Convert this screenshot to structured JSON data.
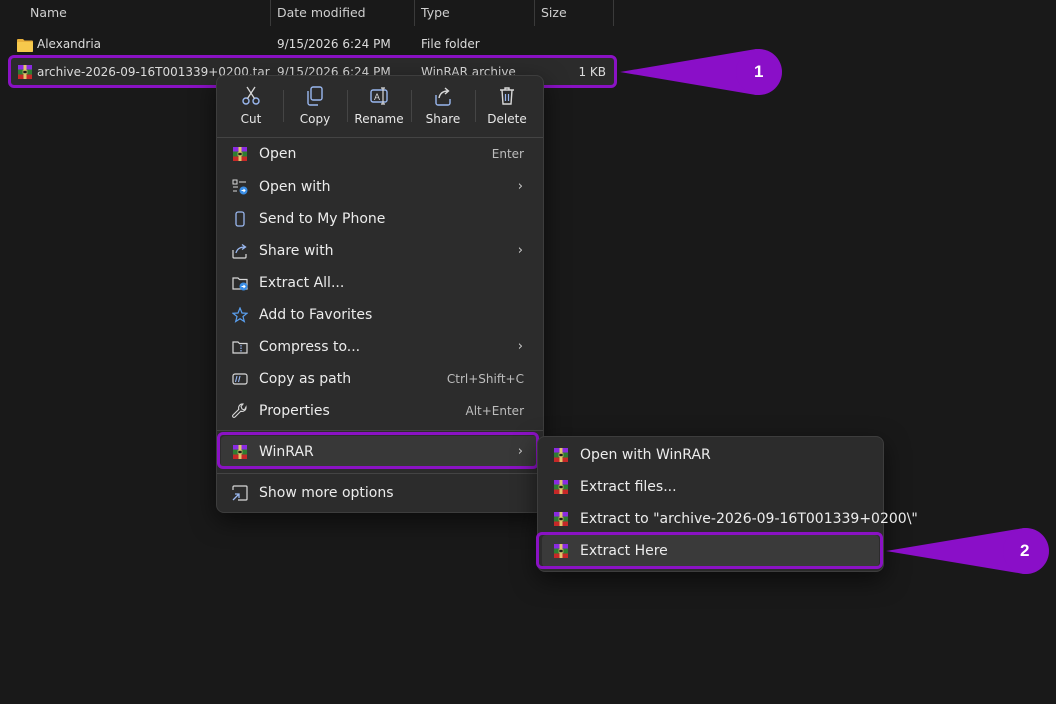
{
  "columns": {
    "name": "Name",
    "date_modified": "Date modified",
    "type": "Type",
    "size": "Size"
  },
  "files": [
    {
      "name": "Alexandria",
      "date": "9/15/2026 6:24 PM",
      "type": "File folder",
      "size": "",
      "icon": "folder-icon"
    },
    {
      "name": "archive-2026-09-16T001339+0200.tar",
      "date": "9/15/2026 6:24 PM",
      "type": "WinRAR archive",
      "size": "1 KB",
      "icon": "winrar-icon"
    }
  ],
  "quick_actions": [
    {
      "label": "Cut",
      "icon": "scissors-icon"
    },
    {
      "label": "Copy",
      "icon": "copy-icon"
    },
    {
      "label": "Rename",
      "icon": "rename-icon"
    },
    {
      "label": "Share",
      "icon": "share-icon"
    },
    {
      "label": "Delete",
      "icon": "trash-icon"
    }
  ],
  "menu_items": [
    {
      "label": "Open",
      "shortcut": "Enter",
      "icon": "winrar-icon"
    },
    {
      "label": "Open with",
      "shortcut": "",
      "icon": "open-with-icon",
      "submenu": true
    },
    {
      "label": "Send to My Phone",
      "shortcut": "",
      "icon": "phone-icon"
    },
    {
      "label": "Share with",
      "shortcut": "",
      "icon": "share-icon",
      "submenu": true
    },
    {
      "label": "Extract All...",
      "shortcut": "",
      "icon": "extract-folder-icon"
    },
    {
      "label": "Add to Favorites",
      "shortcut": "",
      "icon": "star-icon"
    },
    {
      "label": "Compress to...",
      "shortcut": "",
      "icon": "compress-folder-icon",
      "submenu": true
    },
    {
      "label": "Copy as path",
      "shortcut": "Ctrl+Shift+C",
      "icon": "path-icon"
    },
    {
      "label": "Properties",
      "shortcut": "Alt+Enter",
      "icon": "wrench-icon"
    },
    {
      "label": "WinRAR",
      "shortcut": "",
      "icon": "winrar-icon",
      "submenu": true
    },
    {
      "label": "Show more options",
      "shortcut": "",
      "icon": "more-options-icon"
    }
  ],
  "winrar_submenu": [
    {
      "label": "Open with WinRAR",
      "icon": "winrar-icon"
    },
    {
      "label": "Extract files...",
      "icon": "winrar-icon"
    },
    {
      "label": "Extract to \"archive-2026-09-16T001339+0200\\\"",
      "icon": "winrar-icon"
    },
    {
      "label": "Extract Here",
      "icon": "winrar-icon"
    }
  ],
  "callouts": [
    "1",
    "2"
  ],
  "colors": {
    "highlight": "#8a12c4",
    "callout": "#8a0fc8",
    "menu_bg": "#2c2c2c",
    "background": "#191919"
  }
}
